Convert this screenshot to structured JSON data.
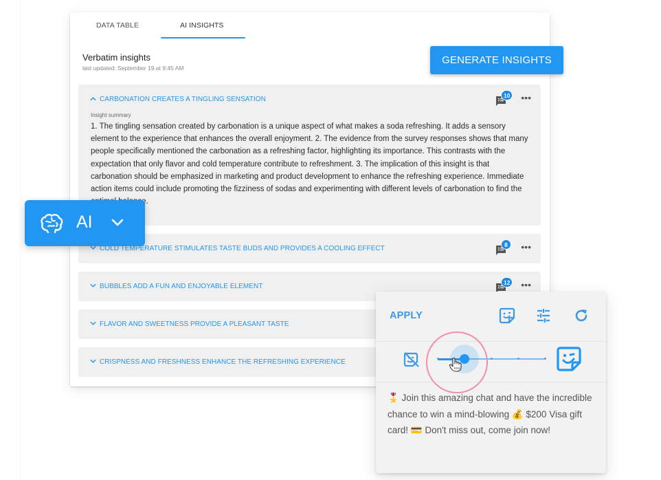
{
  "tabs": [
    {
      "label": "DATA TABLE",
      "active": false
    },
    {
      "label": "AI INSIGHTS",
      "active": true
    }
  ],
  "section": {
    "title": "Verbatim insights",
    "last_updated": "last updated: September 19 at 9:45 AM"
  },
  "generate_button": {
    "label": "GENERATE INSIGHTS"
  },
  "insights": [
    {
      "title": "CARBONATION CREATES A TINGLING SENSATION",
      "expanded": true,
      "comment_count": "10",
      "summary_label": "Insight summary",
      "summary": "1. The tingling sensation created by carbonation is a unique aspect of what makes a soda refreshing. It adds a sensory element to the experience that enhances the overall enjoyment. 2. The evidence from the survey responses shows that many people specifically mentioned the carbonation as a refreshing factor, highlighting its importance. This contrasts with the expectation that only flavor and cold temperature contribute to refreshment. 3. The implication of this insight is that carbonation should be emphasized in marketing and product development to enhance the refreshing experience. Immediate action items could include promoting the fizziness of sodas and experimenting with different levels of carbonation to find the optimal balance."
    },
    {
      "title": "COLD TEMPERATURE STIMULATES TASTE BUDS AND PROVIDES A COOLING EFFECT",
      "expanded": false,
      "comment_count": "8"
    },
    {
      "title": "BUBBLES ADD A FUN AND ENJOYABLE ELEMENT",
      "expanded": false,
      "comment_count": "12"
    },
    {
      "title": "FLAVOR AND SWEETNESS PROVIDE A PLEASANT TASTE",
      "expanded": false
    },
    {
      "title": "CRISPNESS AND FRESHNESS ENHANCE THE REFRESHING EXPERIENCE",
      "expanded": false
    }
  ],
  "more_label": "•••",
  "ai_button": {
    "label": "AI",
    "icon": "brain-icon"
  },
  "popup": {
    "apply_label": "APPLY",
    "icons": [
      "sticker-icon",
      "tune-icon",
      "refresh-icon"
    ],
    "slider": {
      "min_icon": "no-sticker-icon",
      "max_icon": "sticker-icon",
      "stops": 5,
      "value_fraction": 0.25
    },
    "text": "🎖️ Join this amazing chat and have the incredible chance to win a mind-blowing 💰 $200 Visa gift card! 💳 Don't miss out, come join now!"
  },
  "colors": {
    "accent": "#2196f3",
    "insight_bg": "#f0f0f0",
    "focus_ring": "#ee8fb2"
  }
}
